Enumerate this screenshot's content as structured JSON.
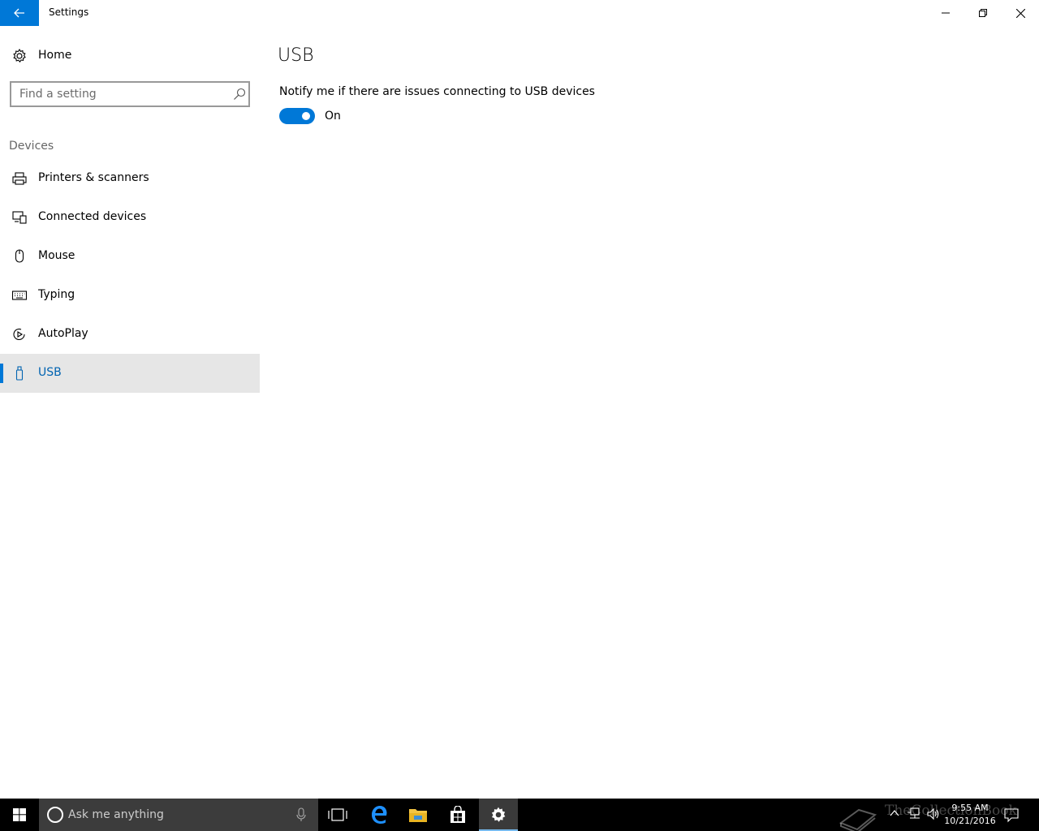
{
  "window": {
    "title": "Settings"
  },
  "sidebar": {
    "home_label": "Home",
    "search_placeholder": "Find a setting",
    "section_label": "Devices",
    "items": [
      {
        "label": "Printers & scanners",
        "icon": "printer-icon"
      },
      {
        "label": "Connected devices",
        "icon": "connected-devices-icon"
      },
      {
        "label": "Mouse",
        "icon": "mouse-icon"
      },
      {
        "label": "Typing",
        "icon": "keyboard-icon"
      },
      {
        "label": "AutoPlay",
        "icon": "autoplay-icon"
      },
      {
        "label": "USB",
        "icon": "usb-icon",
        "selected": true
      }
    ]
  },
  "main": {
    "title": "USB",
    "setting_label": "Notify me if there are issues connecting to USB devices",
    "toggle_state": "On",
    "toggle_on": true
  },
  "taskbar": {
    "search_text": "Ask me anything",
    "clock_time": "9:55 AM",
    "clock_date": "10/21/2016",
    "watermark_text": "TheCollectionBook"
  },
  "colors": {
    "accent": "#0078d7",
    "selected_bg": "#e6e6e6",
    "taskbar_bg": "#000000"
  }
}
